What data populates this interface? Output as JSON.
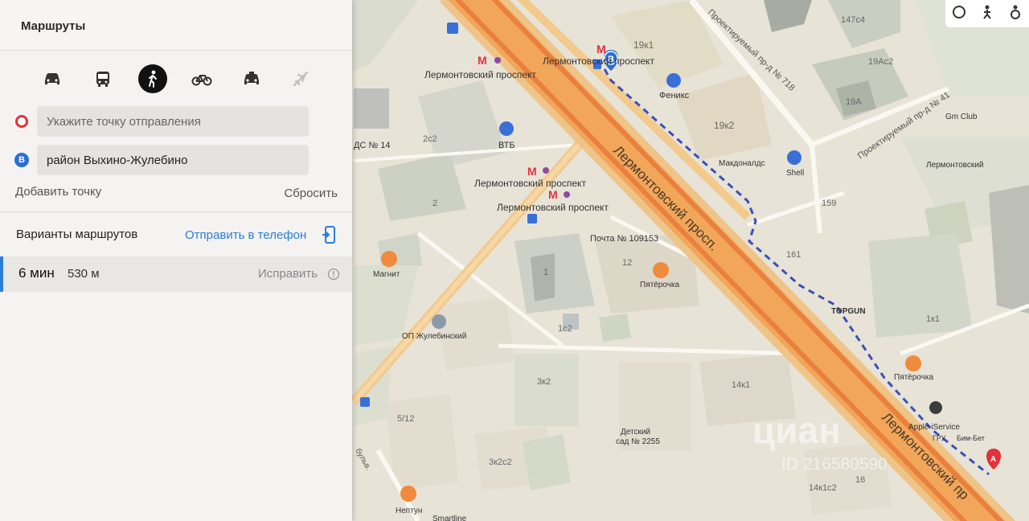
{
  "panel": {
    "title": "Маршруты",
    "modes": [
      "car-icon",
      "bus-icon",
      "walking-icon",
      "bicycle-icon",
      "taxi-icon",
      "plane-icon"
    ],
    "from_placeholder": "Укажите точку отправления",
    "from_pin": "",
    "to_value": "район Выхино-Жулебино",
    "to_pin": "B",
    "add_point": "Добавить точку",
    "reset": "Сбросить",
    "variants_label": "Варианты маршрутов",
    "send_to_phone": "Отправить в телефон",
    "route": {
      "time": "6 мин",
      "distance": "530 м",
      "fix": "Исправить"
    }
  },
  "map": {
    "labels": {
      "metro1": "Лермонтовский проспект",
      "metro2": "Лермонтовский проспект",
      "metro3": "Лермонтовский проспект",
      "metro4": "Лермонтовский проспект",
      "road_main": "Лермонтовский просп.",
      "road_main2": "Лермонтовский пр",
      "road_718": "Проектируемый пр-д № 718",
      "road_41": "Проектируемый пр-д № 41",
      "ds14": "ДС № 14",
      "b2c2": "2с2",
      "b2": "2",
      "b1": "1",
      "b1c2": "1с2",
      "b3k2": "3к2",
      "b3k2c2": "3к2с2",
      "b512": "5/12",
      "b12": "12",
      "b19k1": "19к1",
      "b19k2": "19к2",
      "b19a": "19А",
      "b19ac2": "19Ас2",
      "b147c4": "147с4",
      "b159": "159",
      "b161": "161",
      "b14k1": "14к1",
      "b14k1c2": "14к1с2",
      "b16": "16",
      "b1k1": "1к1",
      "vtb": "ВТБ",
      "feniks": "Феникс",
      "mcd": "Макдоналдс",
      "shell": "Shell",
      "gmclub": "Gm Club",
      "lermontovsky": "Лермонтовский",
      "pochta": "Почта № 109153",
      "pyaterochka1": "Пятёрочка",
      "pyaterochka2": "Пятёрочка",
      "magnit": "Магнит",
      "op": "ОП Жулебинский",
      "topgun": "TOPGUN",
      "detsad": "Детский",
      "detsad2": "сад № 2255",
      "apple": "Apple iService",
      "gru": "ГРУ",
      "bim": "Бим-Бет",
      "neptun": "Нептун",
      "smartline": "Smartline",
      "bulv": "бульв."
    },
    "watermark": "циан",
    "watermark_id": "ID 216580590",
    "marker_b": "B",
    "marker_a": "A",
    "metro_letter": "М"
  },
  "colors": {
    "route_dash": "#3b4fb8",
    "highway": "#f2a65a",
    "highway_core": "#e9803e",
    "active_route": "#2a7ed8",
    "pin_a": "#e0323c",
    "pin_b": "#2a6fcf"
  }
}
